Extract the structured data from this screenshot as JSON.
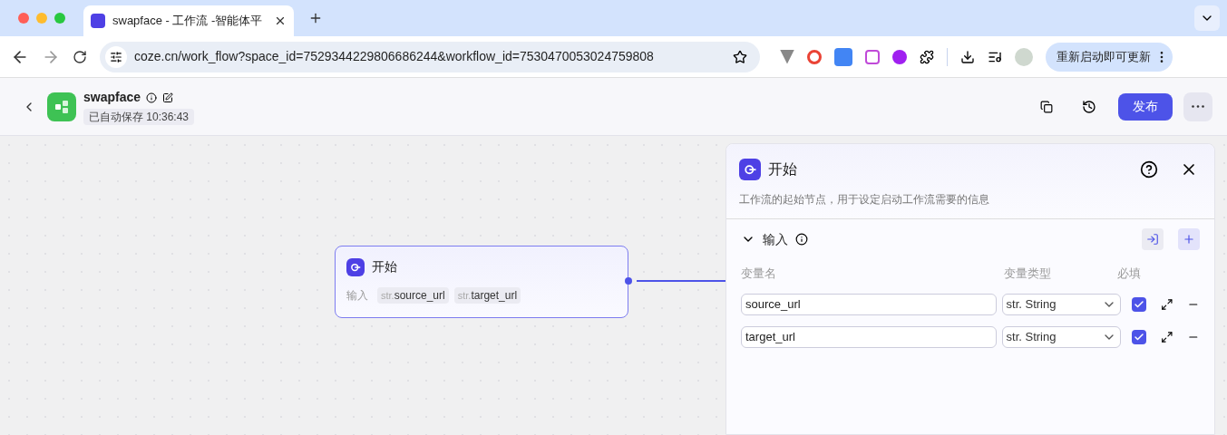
{
  "browser": {
    "tab": {
      "title": "swapface - 工作流 -智能体平"
    },
    "url": "coze.cn/work_flow?space_id=7529344229806686244&workflow_id=7530470053024759808",
    "update_button": "重新启动即可更新"
  },
  "header": {
    "title": "swapface",
    "save_status": "已自动保存 10:36:43",
    "publish_button": "发布"
  },
  "node": {
    "title": "开始",
    "input_label": "输入",
    "params": [
      {
        "type": "str.",
        "name": "source_url"
      },
      {
        "type": "str.",
        "name": "target_url"
      }
    ]
  },
  "panel": {
    "title": "开始",
    "description": "工作流的起始节点，用于设定启动工作流需要的信息",
    "section": {
      "title": "输入",
      "expanded": true
    },
    "columns": [
      "变量名",
      "变量类型",
      "必填"
    ],
    "variables": [
      {
        "name": "source_url",
        "type": "str. String",
        "required": true
      },
      {
        "name": "target_url",
        "type": "str. String",
        "required": true
      }
    ]
  }
}
